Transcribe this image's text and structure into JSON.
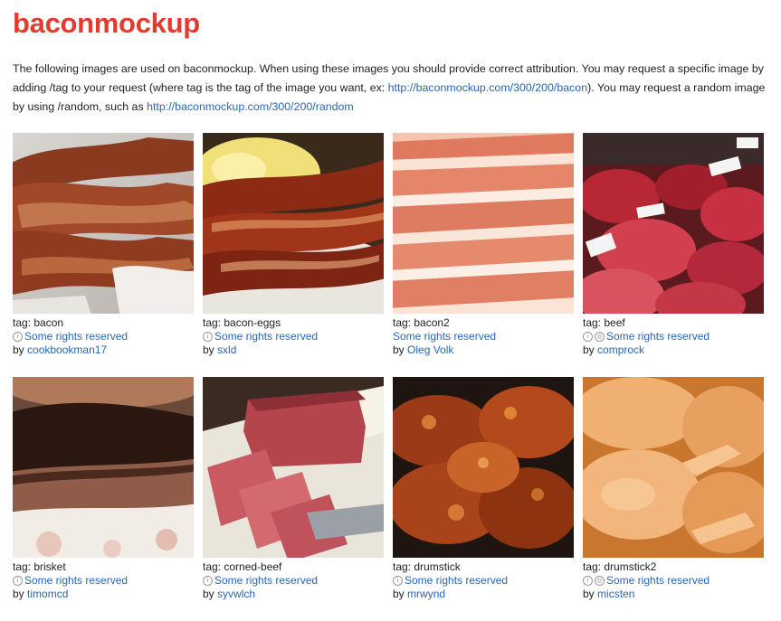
{
  "page": {
    "title": "baconmockup",
    "intro": {
      "text_1": "The following images are used on baconmockup. When using these images you should provide correct attribution. You may request a specific image by adding /tag to your request (where tag is the tag of the image you want, ex: ",
      "link_1": "http://baconmockup.com/300/200/bacon",
      "text_2": "). You may request a random image by using /random, such as ",
      "link_2": "http://baconmockup.com/300/200/random"
    }
  },
  "images": [
    {
      "tag": "tag: bacon",
      "rights": "Some rights reserved",
      "by": "by",
      "author": "cookbookman17",
      "license_icons": [
        "by-icon"
      ]
    },
    {
      "tag": "tag: bacon-eggs",
      "rights": "Some rights reserved",
      "by": "by",
      "author": "sxld",
      "license_icons": [
        "by-icon"
      ]
    },
    {
      "tag": "tag: bacon2",
      "rights": "Some rights reserved",
      "by": "by",
      "author": "Oleg Volk",
      "license_icons": []
    },
    {
      "tag": "tag: beef",
      "rights": "Some rights reserved",
      "by": "by",
      "author": "comprock",
      "license_icons": [
        "by-icon",
        "sa-icon"
      ]
    },
    {
      "tag": "tag: brisket",
      "rights": "Some rights reserved",
      "by": "by",
      "author": "timomcd",
      "license_icons": [
        "by-icon"
      ]
    },
    {
      "tag": "tag: corned-beef",
      "rights": "Some rights reserved",
      "by": "by",
      "author": "syvwlch",
      "license_icons": [
        "by-icon"
      ]
    },
    {
      "tag": "tag: drumstick",
      "rights": "Some rights reserved",
      "by": "by",
      "author": "mrwynd",
      "license_icons": [
        "by-icon"
      ]
    },
    {
      "tag": "tag: drumstick2",
      "rights": "Some rights reserved",
      "by": "by",
      "author": "micsten",
      "license_icons": [
        "by-icon",
        "sa-icon"
      ]
    }
  ]
}
